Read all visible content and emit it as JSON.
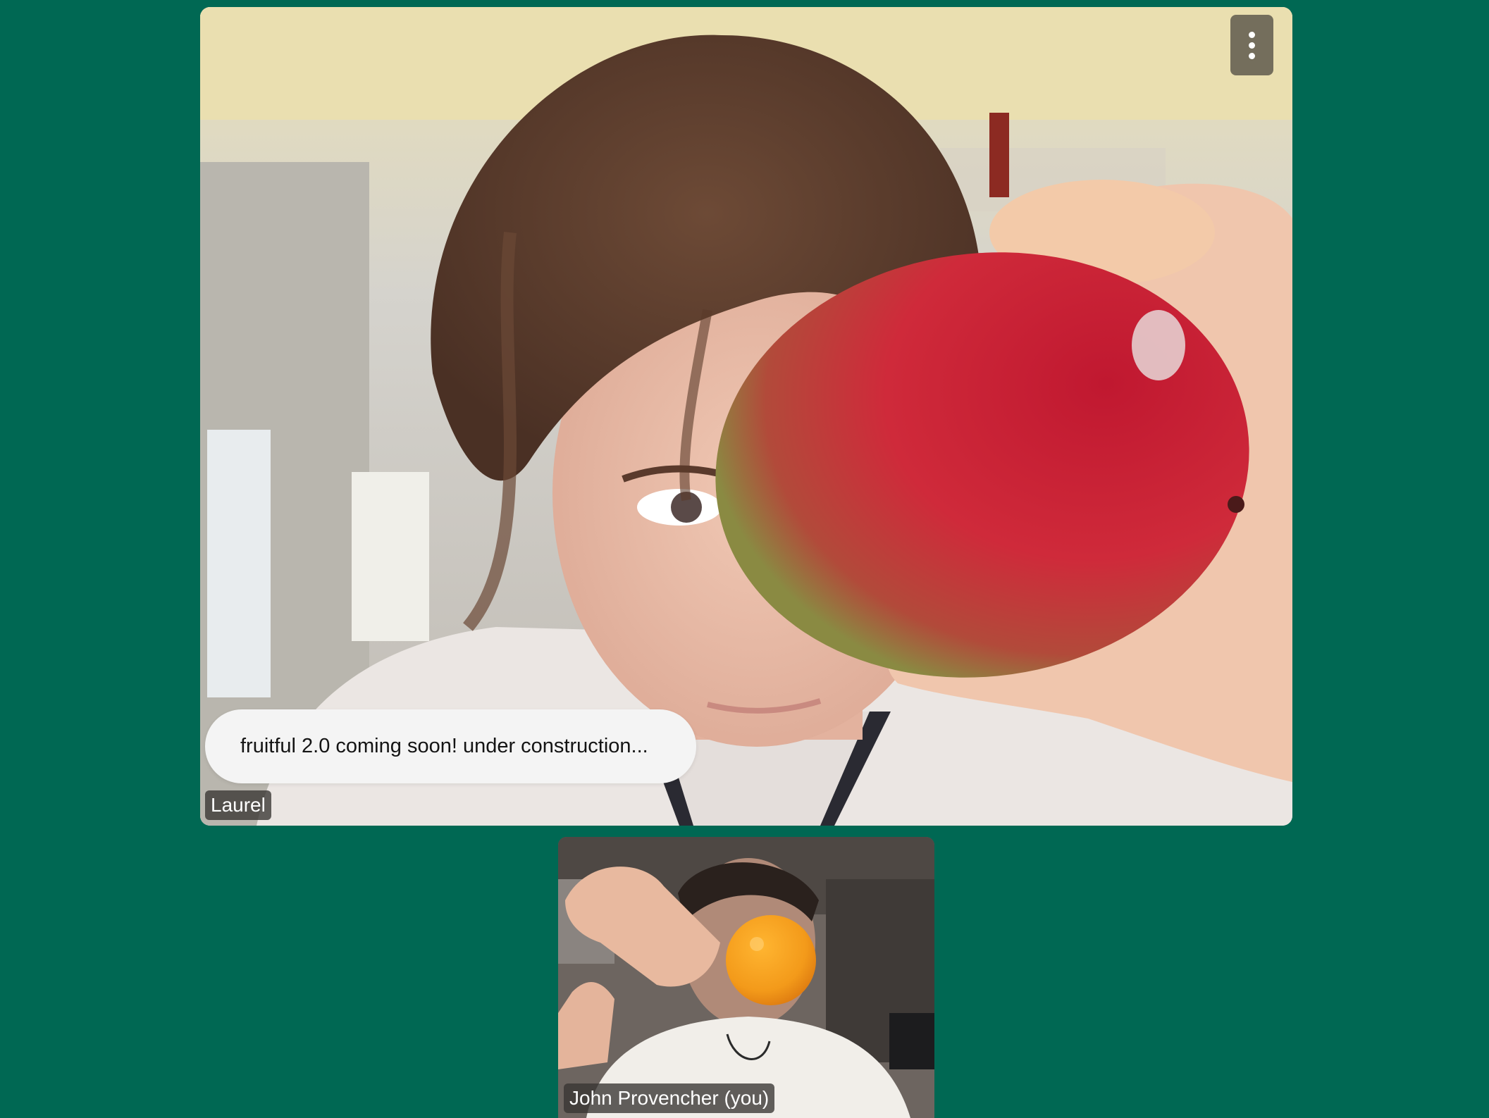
{
  "app": {
    "background_color": "#006853"
  },
  "main_tile": {
    "participant_name": "Laurel",
    "status_message": "fruitful 2.0 coming soon! under construction...",
    "menu_icon": "more-vertical-icon",
    "video_subject": "person holding a red mango over one eye",
    "fruit_color": "#d3283d"
  },
  "self_tile": {
    "participant_name": "John Provencher (you)",
    "video_subject": "person holding an orange clementine over face",
    "fruit_color": "#f39a1a"
  }
}
